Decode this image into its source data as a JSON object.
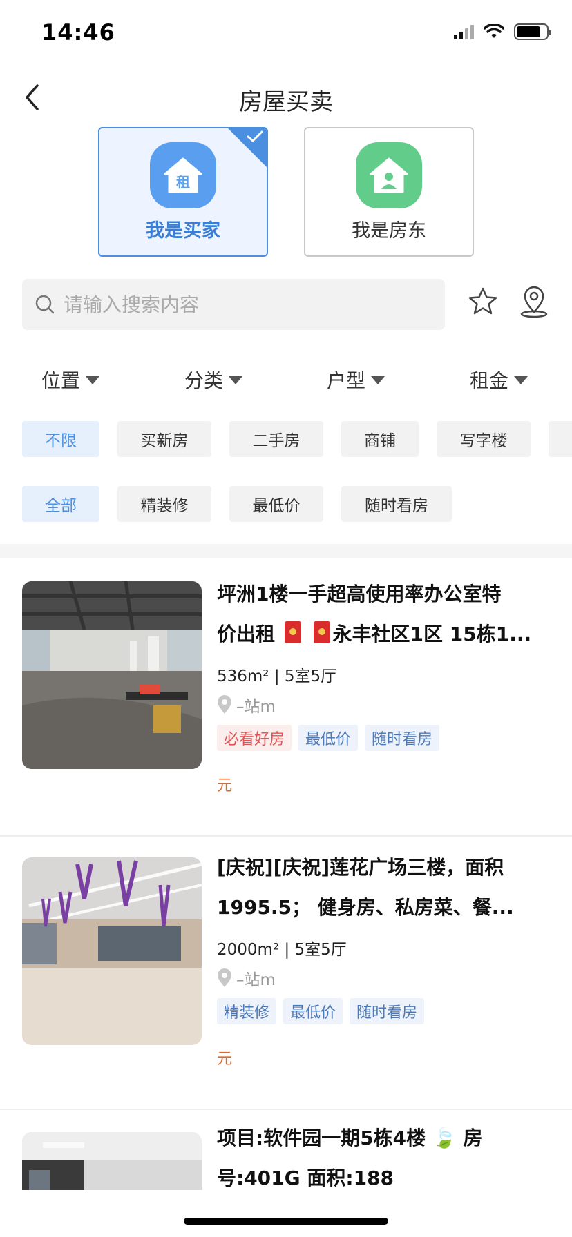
{
  "status": {
    "time": "14:46"
  },
  "nav": {
    "title": "房屋买卖"
  },
  "roles": {
    "buyer_label": "我是买家",
    "buyer_icon_text": "租",
    "owner_label": "我是房东"
  },
  "search": {
    "placeholder": "请输入搜索内容"
  },
  "filters": [
    "位置",
    "分类",
    "户型",
    "租金"
  ],
  "chips_row1": [
    "不限",
    "买新房",
    "二手房",
    "商铺",
    "写字楼"
  ],
  "chips_row2": [
    "全部",
    "精装修",
    "最低价",
    "随时看房"
  ],
  "listings": [
    {
      "title_a": "坪洲1楼一手超高使用率办公室特",
      "title_b_pre": "价出租",
      "title_b_post": "永丰社区1区 15栋1...",
      "area": "536m² | 5室5厅",
      "distance": "–站m",
      "tags": [
        "必看好房",
        "最低价",
        "随时看房"
      ],
      "price": "元"
    },
    {
      "title_a": "[庆祝][庆祝]莲花广场三楼，面积",
      "title_b": "1995.5； 健身房、私房菜、餐...",
      "area": "2000m² | 5室5厅",
      "distance": "–站m",
      "tags": [
        "精装修",
        "最低价",
        "随时看房"
      ],
      "price": "元"
    },
    {
      "title_a": "项目:软件园一期5栋4楼 🍃 房",
      "title_b": "号:401G 面积:188"
    }
  ],
  "colors": {
    "accent": "#4a8fe0",
    "owner_green": "#62cd8a",
    "price": "#e06a2c"
  }
}
